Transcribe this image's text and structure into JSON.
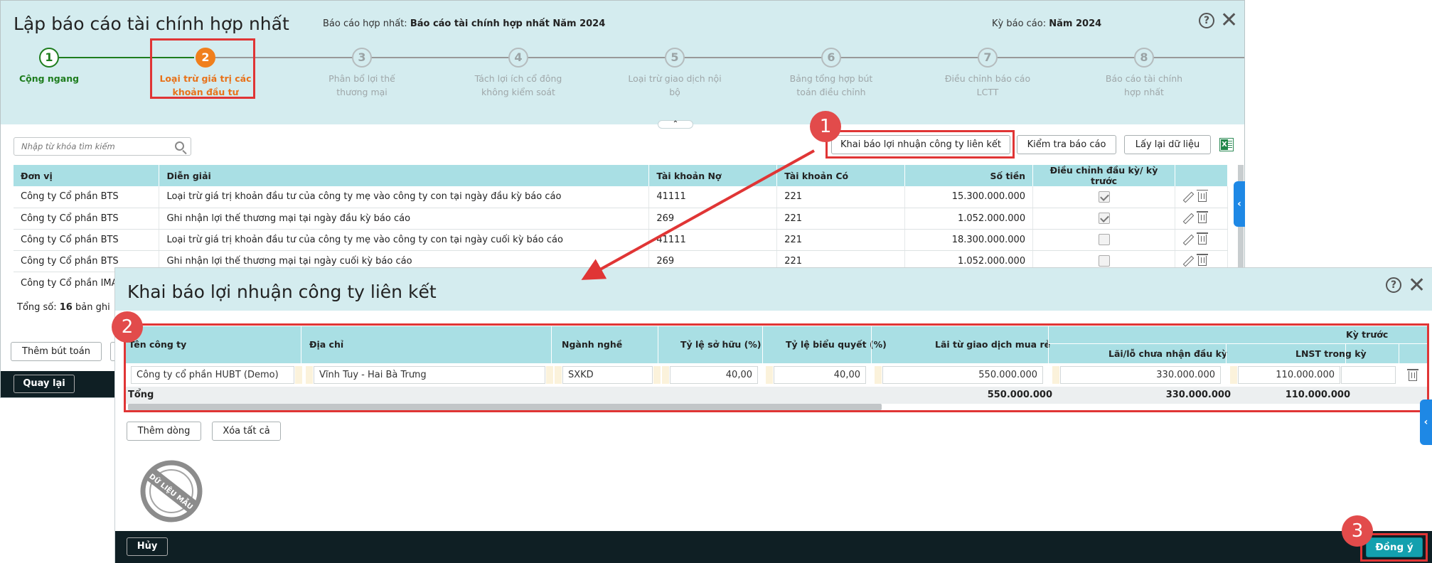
{
  "window": {
    "title": "Lập báo cáo tài chính hợp nhất",
    "consolidated_label": "Báo cáo hợp nhất:",
    "consolidated_value": "Báo cáo tài chính hợp nhất Năm 2024",
    "period_label": "Kỳ báo cáo:",
    "period_value": "Năm 2024",
    "help_glyph": "?",
    "close_glyph": "✕"
  },
  "steps": [
    {
      "num": "1",
      "label": "Cộng ngang",
      "state": "done"
    },
    {
      "num": "2",
      "label": "Loại trừ giá trị các khoản đầu tư",
      "state": "current"
    },
    {
      "num": "3",
      "label": "Phân bổ lợi thế thương mại",
      "state": "pending"
    },
    {
      "num": "4",
      "label": "Tách lợi ích cổ đông không kiểm soát",
      "state": "pending"
    },
    {
      "num": "5",
      "label": "Loại trừ giao dịch nội bộ",
      "state": "pending"
    },
    {
      "num": "6",
      "label": "Bảng tổng hợp bút toán điều chỉnh",
      "state": "pending"
    },
    {
      "num": "7",
      "label": "Điều chỉnh báo cáo LCTT",
      "state": "pending"
    },
    {
      "num": "8",
      "label": "Báo cáo tài chính hợp nhất",
      "state": "pending"
    }
  ],
  "toolbar": {
    "search_placeholder": "Nhập từ khóa tìm kiếm",
    "declare_btn": "Khai báo lợi nhuận công ty liên kết",
    "check_btn": "Kiểm tra báo cáo",
    "reload_btn": "Lấy lại dữ liệu",
    "collapse_glyph": "⌃"
  },
  "grid": {
    "headers": [
      "Đơn vị",
      "Diễn giải",
      "Tài khoản Nợ",
      "Tài khoản Có",
      "Số tiền",
      "Điều chỉnh đầu kỳ/ kỳ trước"
    ],
    "rows": [
      {
        "unit": "Công ty Cổ phần BTS",
        "desc": "Loại trừ giá trị khoản đầu tư của công ty mẹ vào công ty con tại ngày đầu kỳ báo cáo",
        "debit": "41111",
        "credit": "221",
        "amount": "15.300.000.000",
        "adjust": true
      },
      {
        "unit": "Công ty Cổ phần BTS",
        "desc": "Ghi nhận lợi thế thương mại tại ngày đầu kỳ báo cáo",
        "debit": "269",
        "credit": "221",
        "amount": "1.052.000.000",
        "adjust": true
      },
      {
        "unit": "Công ty Cổ phần BTS",
        "desc": "Loại trừ giá trị khoản đầu tư của công ty mẹ vào công ty con tại ngày cuối kỳ báo cáo",
        "debit": "41111",
        "credit": "221",
        "amount": "18.300.000.000",
        "adjust": false
      },
      {
        "unit": "Công ty Cổ phần BTS",
        "desc": "Ghi nhận lợi thế thương mại tại ngày cuối kỳ báo cáo",
        "debit": "269",
        "credit": "221",
        "amount": "1.052.000.000",
        "adjust": false
      }
    ],
    "partial_row_unit": "Công ty Cổ phần IMA",
    "total_label": "Tổng số:",
    "total_count": "16",
    "total_suffix": "bản ghi",
    "add_entry_btn": "Thêm bút toán"
  },
  "footer": {
    "back_btn": "Quay lại"
  },
  "side_tab_glyph": "‹",
  "dialog": {
    "title": "Khai báo lợi nhuận công ty liên kết",
    "help_glyph": "?",
    "close_glyph": "✕",
    "headers": {
      "company": "Tên công ty",
      "address": "Địa chỉ",
      "industry": "Ngành nghề",
      "ownership": "Tỷ lệ sở hữu (%)",
      "voting": "Tỷ lệ biểu quyết (%)",
      "bargain": "Lãi từ giao dịch mua rẻ",
      "prior_group": "Kỳ trước",
      "unrecognized": "Lãi/lỗ chưa nhận đầu kỳ",
      "lnst": "LNST trong kỳ"
    },
    "row": {
      "company": "Công ty cổ phần HUBT (Demo)",
      "address": "Vĩnh Tuy - Hai Bà Trưng",
      "industry": "SXKD",
      "ownership": "40,00",
      "voting": "40,00",
      "bargain": "550.000.000",
      "unrecognized": "330.000.000",
      "lnst": "110.000.000"
    },
    "total": {
      "label": "Tổng",
      "bargain": "550.000.000",
      "unrecognized": "330.000.000",
      "lnst": "110.000.000"
    },
    "add_row_btn": "Thêm dòng",
    "clear_all_btn": "Xóa tất cả",
    "cancel_btn": "Hủy",
    "ok_btn": "Đồng ý",
    "stamp_text": "DỮ LIỆU MẪU"
  },
  "badges": [
    "1",
    "2",
    "3"
  ],
  "colors": {
    "header_bg": "#d4ecef",
    "table_header": "#a9dfe4",
    "done_green": "#1e7d1e",
    "current_orange": "#f07f1c",
    "highlight_red": "#e03535",
    "footer_dark": "#0f1f24",
    "primary_teal": "#13a0ae",
    "side_tab_blue": "#1e88e5"
  }
}
